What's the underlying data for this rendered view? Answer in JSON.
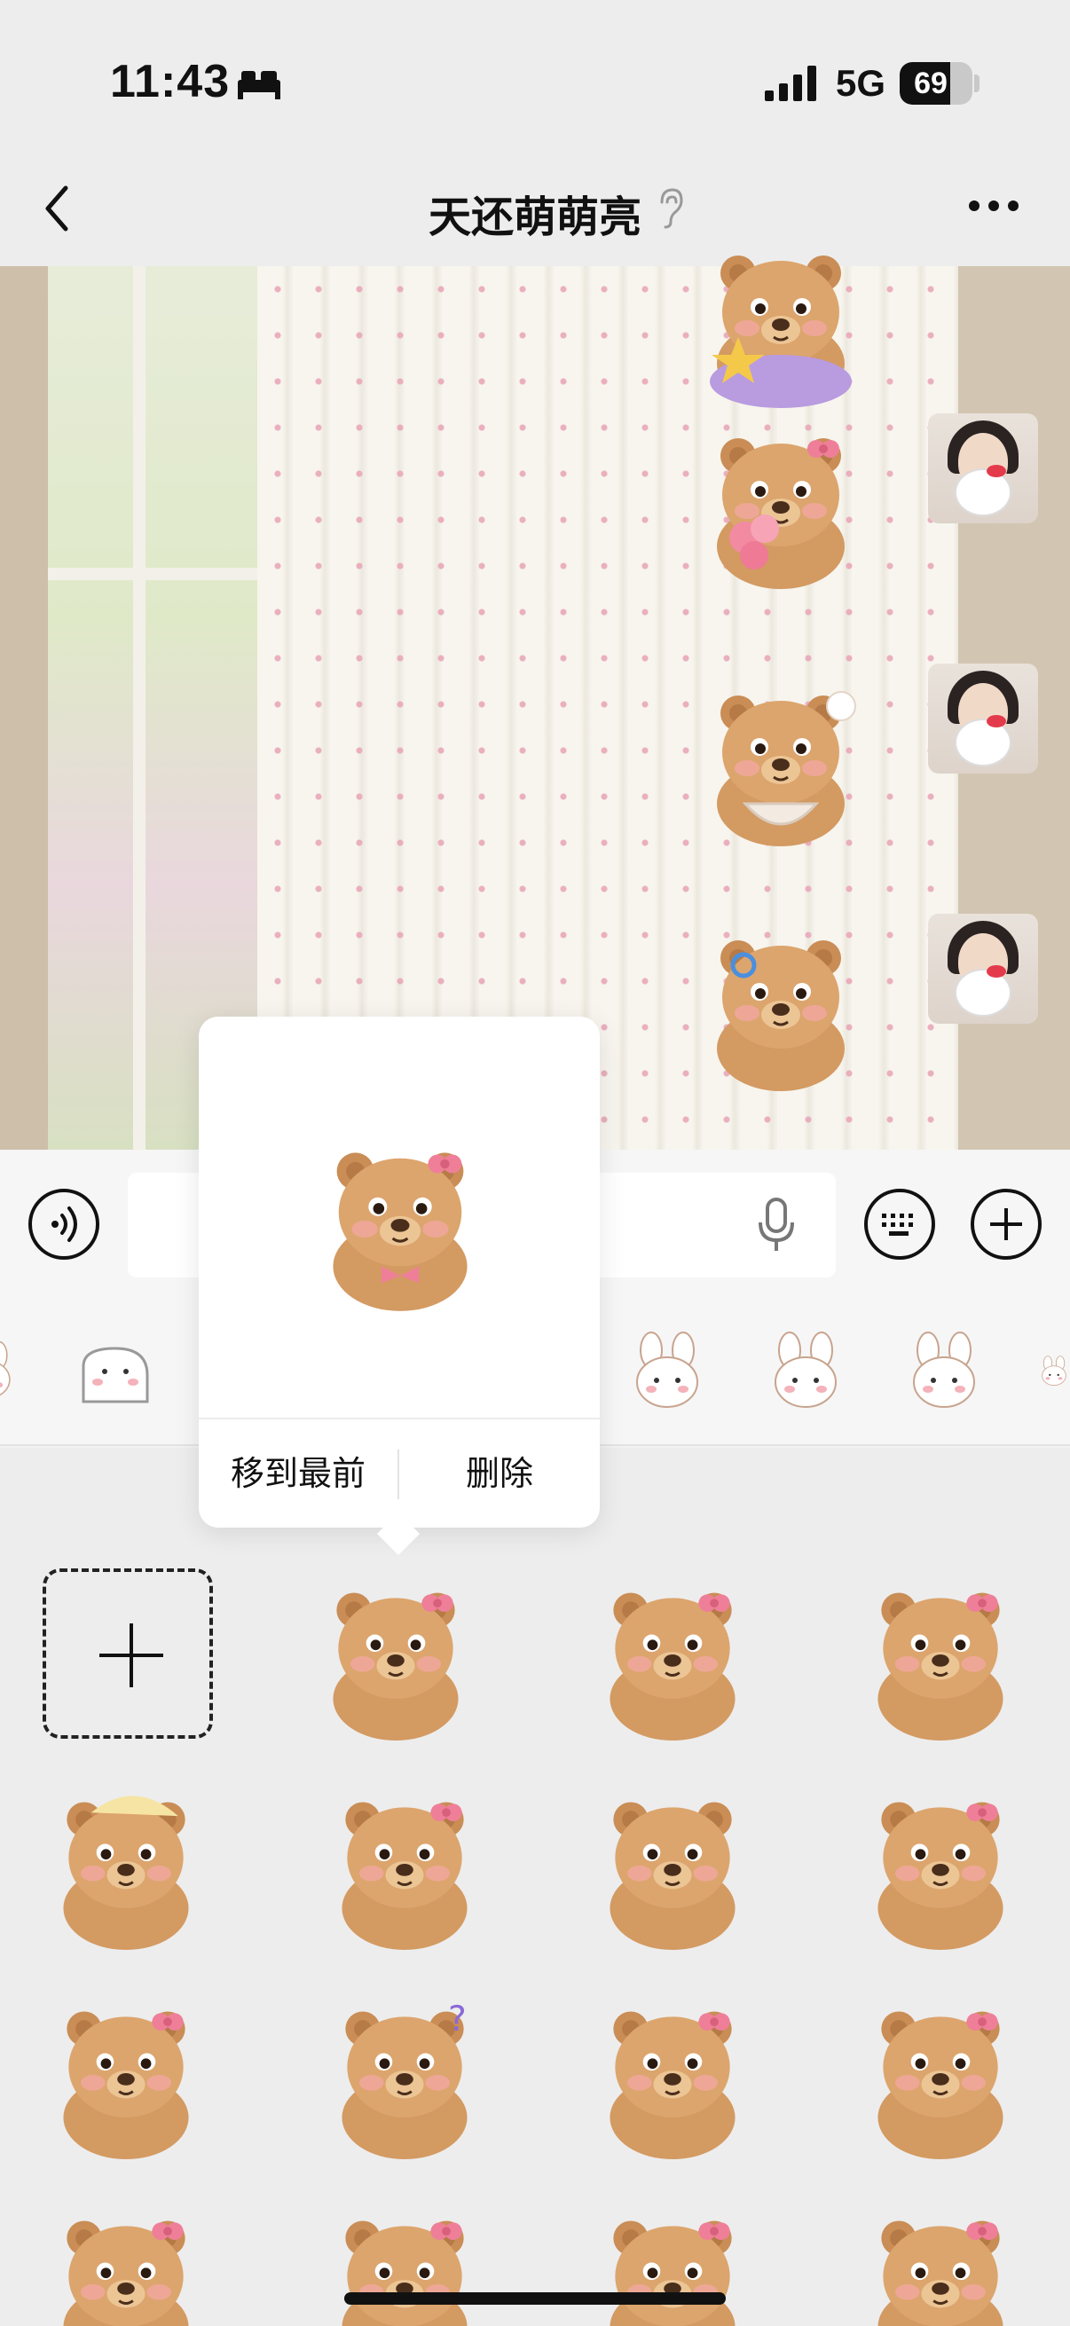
{
  "status_bar": {
    "time": "11:43",
    "network": "5G",
    "battery": "69",
    "battery_level": 0.69
  },
  "nav": {
    "title": "天还萌萌亮"
  },
  "popover": {
    "move_to_front": "移到最前",
    "delete": "删除"
  },
  "colors": {
    "bear_fur": "#d9a06a",
    "bear_dark": "#8a5a34",
    "bear_cheek": "#f2a7a0",
    "bow_pink": "#ef7f98"
  }
}
